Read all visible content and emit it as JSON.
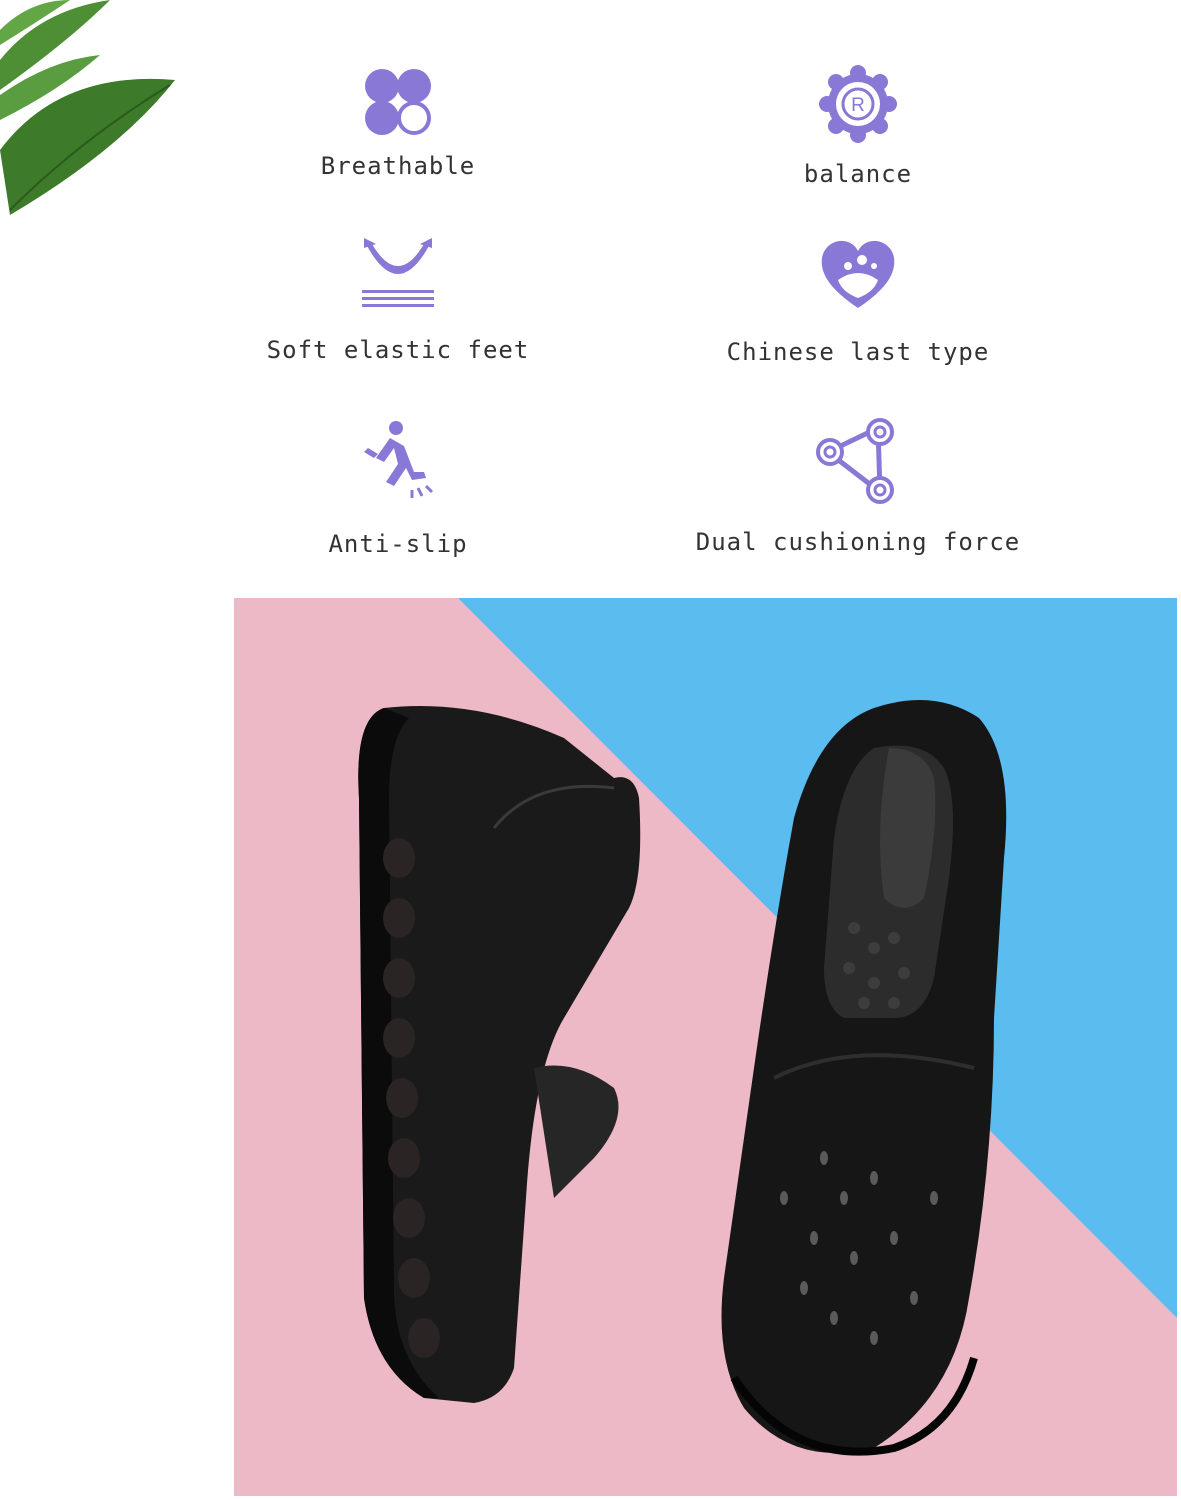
{
  "features": [
    {
      "label": "Breathable",
      "icon": "clover-icon"
    },
    {
      "label": "balance",
      "icon": "registered-badge-icon"
    },
    {
      "label": "Soft elastic feet",
      "icon": "cushion-arrow-icon"
    },
    {
      "label": "Chinese last type",
      "icon": "heart-foot-icon"
    },
    {
      "label": "Anti-slip",
      "icon": "slipping-person-icon"
    },
    {
      "label": "Dual cushioning force",
      "icon": "pulley-icon"
    }
  ],
  "colors": {
    "icon_purple": "#8a78d6",
    "background_pink": "#eeb9c6",
    "background_blue": "#5bbcf0",
    "shoe_black": "#141414",
    "leaf_green": "#3d7a2a"
  }
}
